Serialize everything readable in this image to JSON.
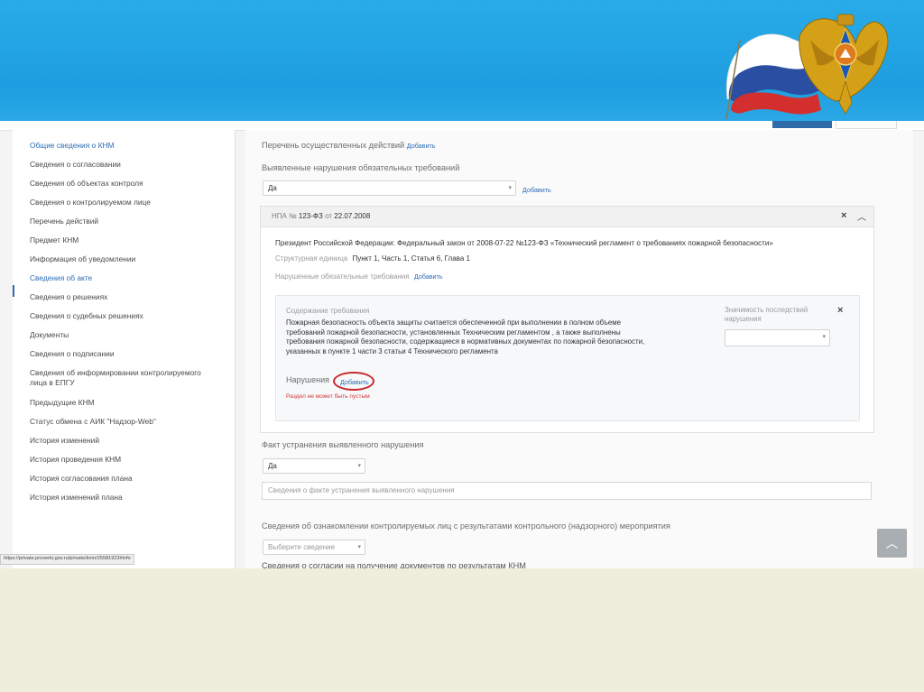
{
  "sidebar": {
    "items": [
      {
        "label": "Общие сведения о КНМ",
        "style": "link"
      },
      {
        "label": "Сведения о согласовании"
      },
      {
        "label": "Сведения об объектах контроля"
      },
      {
        "label": "Сведения о контролируемом лице"
      },
      {
        "label": "Перечень действий"
      },
      {
        "label": "Предмет КНМ"
      },
      {
        "label": "Информация об уведомлении"
      },
      {
        "label": "Сведения об акте",
        "style": "active"
      },
      {
        "label": "Сведения о решениях"
      },
      {
        "label": "Сведения о судебных решениях"
      },
      {
        "label": "Документы"
      },
      {
        "label": "Сведения о подписании"
      },
      {
        "label": "Сведения об информировании контролируемого",
        "label2": "лица в ЕПГУ"
      },
      {
        "label": "Предыдущие КНМ"
      },
      {
        "label": "Статус обмена с АИК \"Надзор-Web\""
      },
      {
        "label": "История изменений"
      },
      {
        "label": "История проведения КНМ"
      },
      {
        "label": "История согласования плана"
      },
      {
        "label": "История изменений плана"
      }
    ]
  },
  "main": {
    "actions_label": "Перечень осуществленных действий",
    "add_label": "Добавить",
    "violations_label": "Выявленные нарушения обязательных требований",
    "violations_value": "Да",
    "npa": {
      "prefix": "НПА №",
      "number": "123-ФЗ",
      "date_prefix": "от",
      "date": "22.07.2008",
      "law_title": "Президент Российской Федерации: Федеральный закон от 2008-07-22 №123-ФЗ «Технический регламент о требованиях пожарной безопасности»",
      "struct_label": "Структурная единица",
      "struct_value": "Пункт 1, Часть 1, Статья 6, Глава 1",
      "broken_label": "Нарушенные обязательные требования"
    },
    "requirement": {
      "label": "Содержание требования",
      "lines": [
        "Пожарная безопасность объекта защиты считается обеспеченной при выполнении в полном объеме",
        "требований пожарной безопасности, установленных Техническим регламентом , а также выполнены",
        "требования пожарной безопасности, содержащиеся в нормативных документах по пожарной безопасности,",
        "указанных в пункте 1 части 3 статьи 4 Технического регламента"
      ],
      "significance_label_1": "Значимость последствий",
      "significance_label_2": "нарушения",
      "violation_label": "Нарушения",
      "error_text": "Раздел не может быть пустым"
    },
    "fix_label": "Факт устранения выявленного нарушения",
    "fix_value": "Да",
    "fix_placeholder": "Сведения о факте устранения выявленного нарушения",
    "familiar_label": "Сведения об ознакомлении контролируемых лиц с результатами контрольного (надзорного) мероприятия",
    "familiar_placeholder": "Выберите сведение",
    "cut_label": "Сведения о согласии на получение документов по результатам КНМ"
  },
  "statusbar_url": "https://private.proverki.gov.ru/private/knm/25581923#info",
  "colors": {
    "banner": "#1e9ee0",
    "link": "#2d6db5",
    "error": "#d23b3b",
    "highlight": "#c8262a"
  }
}
